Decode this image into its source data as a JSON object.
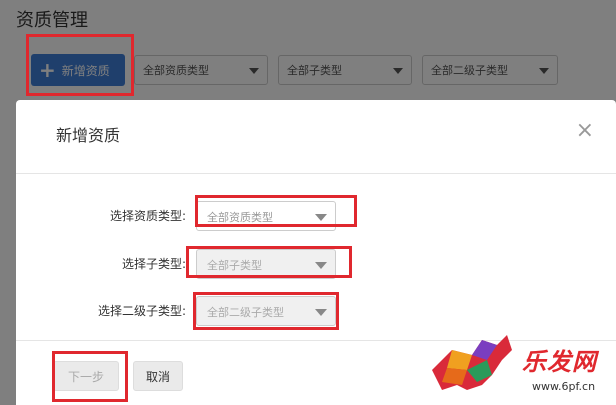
{
  "background": {
    "title": "资质管理",
    "add_button": "新增资质",
    "filters": [
      "全部资质类型",
      "全部子类型",
      "全部二级子类型"
    ]
  },
  "modal": {
    "title": "新增资质",
    "close_glyph": "×",
    "fields": [
      {
        "label": "选择资质类型:",
        "value": "全部资质类型"
      },
      {
        "label": "选择子类型:",
        "value": "全部子类型"
      },
      {
        "label": "选择二级子类型:",
        "value": "全部二级子类型"
      }
    ],
    "next_label": "下一步",
    "cancel_label": "取消"
  },
  "watermark": {
    "text": "乐发网",
    "url": "www.6pf.cn"
  },
  "colors": {
    "primary": "#3f7fd9",
    "highlight": "#e0282e",
    "overlay": "rgba(0,0,0,0.5)"
  }
}
